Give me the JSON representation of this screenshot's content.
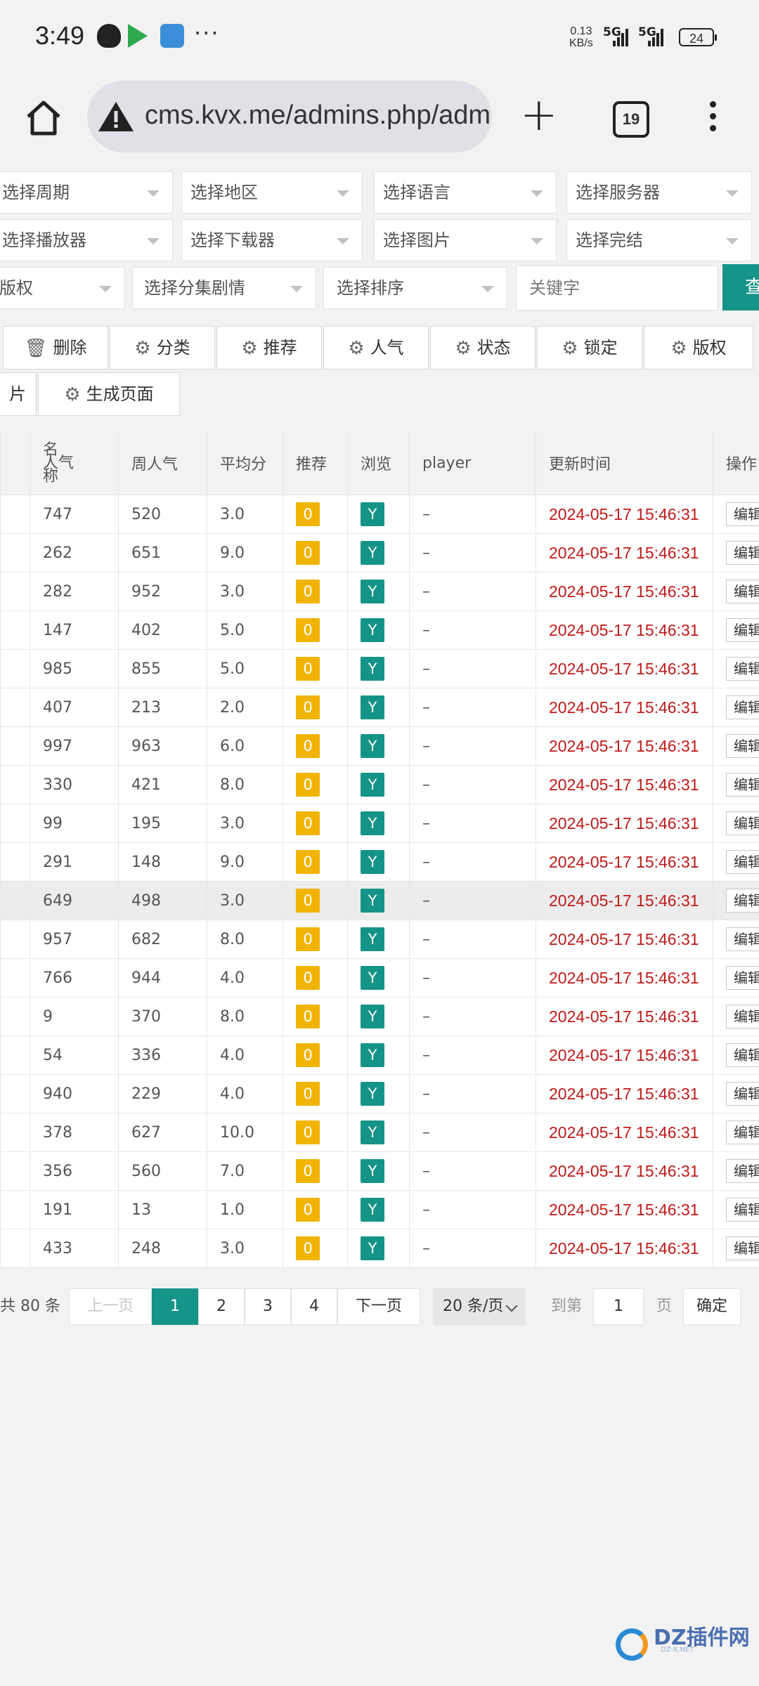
{
  "status_bar": {
    "time": "3:49",
    "more": "···",
    "speed_value": "0.13",
    "speed_unit": "KB/s",
    "net1": "5G",
    "net2": "5G",
    "battery": "24"
  },
  "browser": {
    "url": "cms.kvx.me/admins.php/adm",
    "tab_count": "19"
  },
  "filters": {
    "period": "选择周期",
    "region": "选择地区",
    "language": "选择语言",
    "server": "选择服务器",
    "player": "选择播放器",
    "downloader": "选择下载器",
    "picture": "选择图片",
    "finished": "选择完结",
    "copyright": "版权",
    "episode_plot": "选择分集剧情",
    "sort": "选择排序",
    "keyword_placeholder": "关键字",
    "search_button": "查"
  },
  "toolbar": {
    "delete": "删除",
    "category": "分类",
    "recommend": "推荐",
    "popularity": "人气",
    "status": "状态",
    "lock": "锁定",
    "copyright": "版权",
    "picture": "片",
    "generate_page": "生成页面"
  },
  "table": {
    "headers": {
      "name_pop_line1": "名",
      "name_pop_line2": "人气",
      "name_pop_line3": "称",
      "week_pop": "周人气",
      "avg_score": "平均分",
      "recommend": "推荐",
      "browse": "浏览",
      "player": "player",
      "update_time": "更新时间",
      "actions": "操作"
    },
    "rows": [
      {
        "hits": "747",
        "week": "520",
        "score": "3.0",
        "rec": "0",
        "browse": "Y",
        "player": "–",
        "time": "2024-05-17 15:46:31",
        "edit": "编辑"
      },
      {
        "hits": "262",
        "week": "651",
        "score": "9.0",
        "rec": "0",
        "browse": "Y",
        "player": "–",
        "time": "2024-05-17 15:46:31",
        "edit": "编辑"
      },
      {
        "hits": "282",
        "week": "952",
        "score": "3.0",
        "rec": "0",
        "browse": "Y",
        "player": "–",
        "time": "2024-05-17 15:46:31",
        "edit": "编辑"
      },
      {
        "hits": "147",
        "week": "402",
        "score": "5.0",
        "rec": "0",
        "browse": "Y",
        "player": "–",
        "time": "2024-05-17 15:46:31",
        "edit": "编辑"
      },
      {
        "hits": "985",
        "week": "855",
        "score": "5.0",
        "rec": "0",
        "browse": "Y",
        "player": "–",
        "time": "2024-05-17 15:46:31",
        "edit": "编辑"
      },
      {
        "hits": "407",
        "week": "213",
        "score": "2.0",
        "rec": "0",
        "browse": "Y",
        "player": "–",
        "time": "2024-05-17 15:46:31",
        "edit": "编辑"
      },
      {
        "hits": "997",
        "week": "963",
        "score": "6.0",
        "rec": "0",
        "browse": "Y",
        "player": "–",
        "time": "2024-05-17 15:46:31",
        "edit": "编辑"
      },
      {
        "hits": "330",
        "week": "421",
        "score": "8.0",
        "rec": "0",
        "browse": "Y",
        "player": "–",
        "time": "2024-05-17 15:46:31",
        "edit": "编辑"
      },
      {
        "hits": "99",
        "week": "195",
        "score": "3.0",
        "rec": "0",
        "browse": "Y",
        "player": "–",
        "time": "2024-05-17 15:46:31",
        "edit": "编辑"
      },
      {
        "hits": "291",
        "week": "148",
        "score": "9.0",
        "rec": "0",
        "browse": "Y",
        "player": "–",
        "time": "2024-05-17 15:46:31",
        "edit": "编辑"
      },
      {
        "hits": "649",
        "week": "498",
        "score": "3.0",
        "rec": "0",
        "browse": "Y",
        "player": "–",
        "time": "2024-05-17 15:46:31",
        "edit": "编辑",
        "highlight": true
      },
      {
        "hits": "957",
        "week": "682",
        "score": "8.0",
        "rec": "0",
        "browse": "Y",
        "player": "–",
        "time": "2024-05-17 15:46:31",
        "edit": "编辑"
      },
      {
        "hits": "766",
        "week": "944",
        "score": "4.0",
        "rec": "0",
        "browse": "Y",
        "player": "–",
        "time": "2024-05-17 15:46:31",
        "edit": "编辑"
      },
      {
        "hits": "9",
        "week": "370",
        "score": "8.0",
        "rec": "0",
        "browse": "Y",
        "player": "–",
        "time": "2024-05-17 15:46:31",
        "edit": "编辑"
      },
      {
        "hits": "54",
        "week": "336",
        "score": "4.0",
        "rec": "0",
        "browse": "Y",
        "player": "–",
        "time": "2024-05-17 15:46:31",
        "edit": "编辑"
      },
      {
        "hits": "940",
        "week": "229",
        "score": "4.0",
        "rec": "0",
        "browse": "Y",
        "player": "–",
        "time": "2024-05-17 15:46:31",
        "edit": "编辑"
      },
      {
        "hits": "378",
        "week": "627",
        "score": "10.0",
        "rec": "0",
        "browse": "Y",
        "player": "–",
        "time": "2024-05-17 15:46:31",
        "edit": "编辑"
      },
      {
        "hits": "356",
        "week": "560",
        "score": "7.0",
        "rec": "0",
        "browse": "Y",
        "player": "–",
        "time": "2024-05-17 15:46:31",
        "edit": "编辑"
      },
      {
        "hits": "191",
        "week": "13",
        "score": "1.0",
        "rec": "0",
        "browse": "Y",
        "player": "–",
        "time": "2024-05-17 15:46:31",
        "edit": "编辑"
      },
      {
        "hits": "433",
        "week": "248",
        "score": "3.0",
        "rec": "0",
        "browse": "Y",
        "player": "–",
        "time": "2024-05-17 15:46:31",
        "edit": "编辑"
      }
    ]
  },
  "pagination": {
    "total": "共 80 条",
    "prev": "上一页",
    "pages": [
      "1",
      "2",
      "3",
      "4"
    ],
    "next": "下一页",
    "page_size": "20 条/页",
    "goto_label": "到第",
    "goto_value": "1",
    "page_unit": "页",
    "confirm": "确定"
  },
  "watermark": {
    "brand": "DZ插件网",
    "sub": "DZ-X.NET"
  },
  "colors": {
    "accent": "#159488",
    "badge_orange": "#f1b400",
    "time_red": "#c01a1a"
  }
}
